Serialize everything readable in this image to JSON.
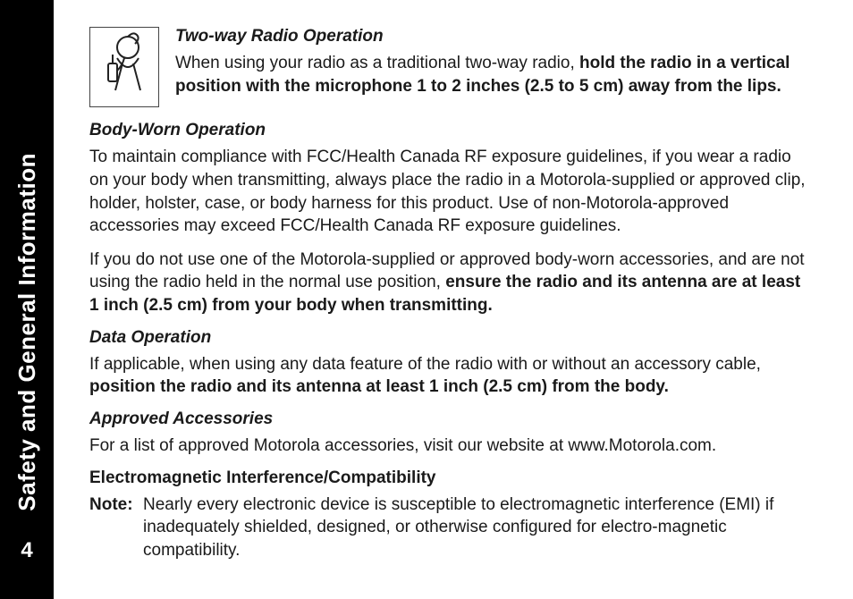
{
  "page_number": "4",
  "side_title": "Safety and General Information",
  "sections": {
    "two_way": {
      "heading": "Two-way Radio Operation",
      "text_prefix": "When using your radio as a traditional two-way radio, ",
      "text_bold": "hold the radio in a vertical position with the microphone 1 to 2 inches (2.5 to 5 cm) away from the lips."
    },
    "body_worn": {
      "heading": "Body-Worn Operation",
      "p1": "To maintain compliance with FCC/Health Canada RF exposure guidelines, if you wear a radio on your body when transmitting, always place the radio in a Motorola-supplied or approved clip, holder, holster, case, or body harness for this product. Use of non-Motorola-approved accessories may exceed FCC/Health Canada RF exposure guidelines.",
      "p2_prefix": "If you do not use one of the Motorola-supplied or approved body-worn accessories, and are not using the radio held in the normal use position, ",
      "p2_bold": "ensure the radio and its antenna are at least 1 inch (2.5 cm) from your body when transmitting."
    },
    "data_op": {
      "heading": "Data Operation",
      "text_prefix": "If applicable, when using any data feature of the radio with or without an accessory cable, ",
      "text_bold": "position the radio and its antenna at least 1 inch (2.5 cm) from the body."
    },
    "approved": {
      "heading": "Approved Accessories",
      "text": "For a list of approved Motorola accessories, visit our website at www.Motorola.com."
    },
    "emi": {
      "heading": "Electromagnetic Interference/Compatibility",
      "note_label": "Note:",
      "note_text": "Nearly every electronic device is susceptible to electromagnetic interference (EMI) if inadequately shielded, designed, or otherwise configured for electro-magnetic compatibility."
    }
  }
}
